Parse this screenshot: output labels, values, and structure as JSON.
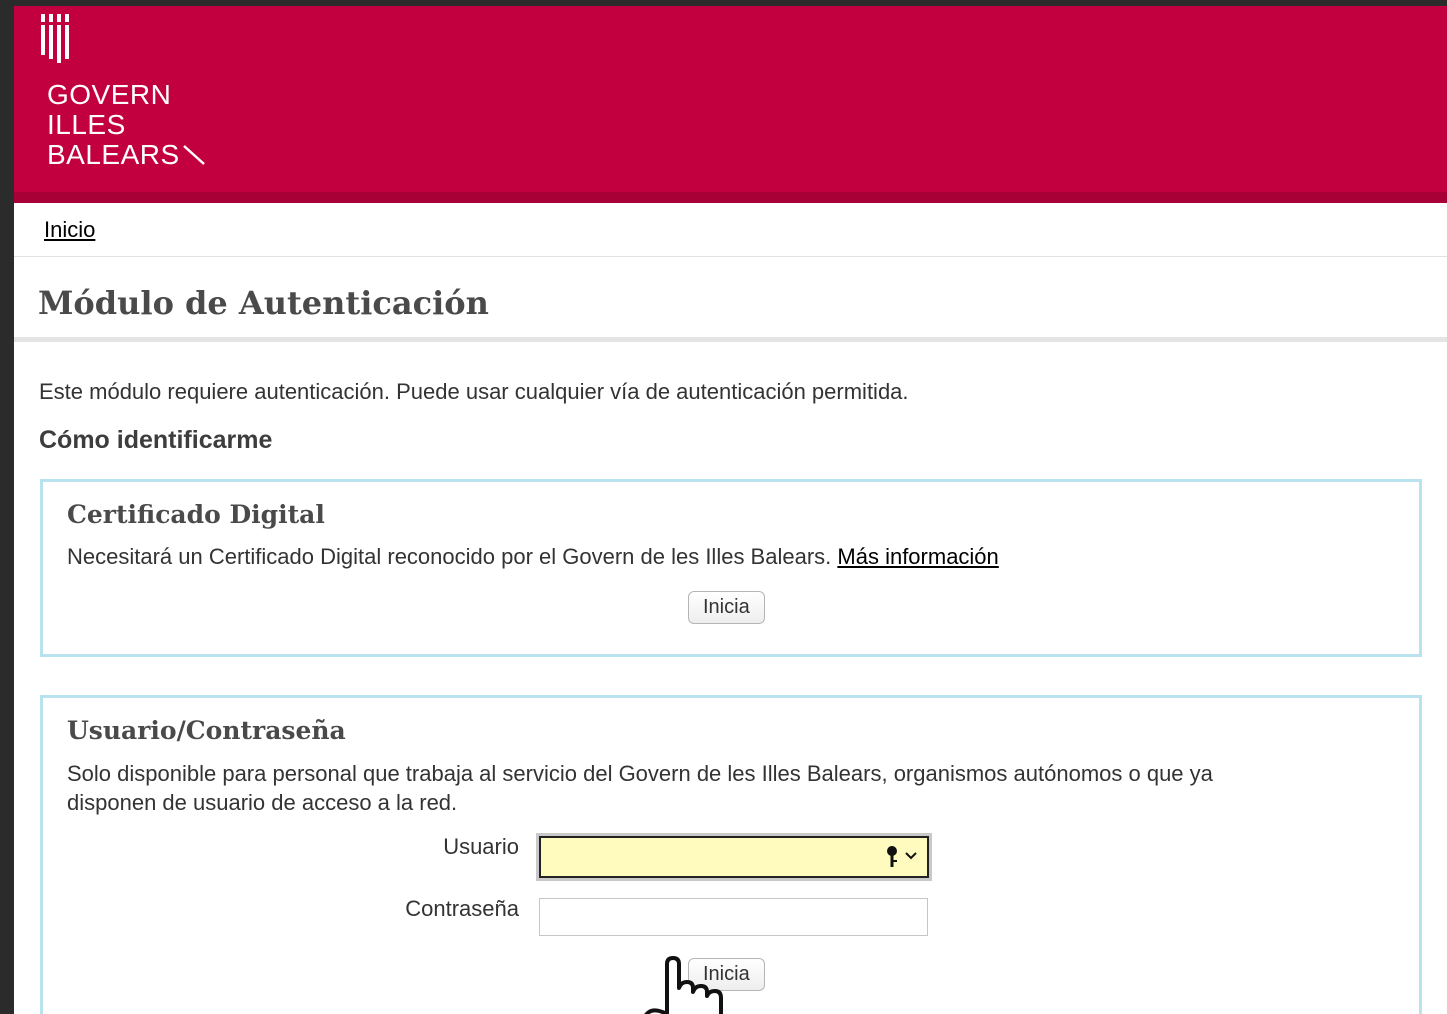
{
  "header": {
    "logo_lines": [
      "GOVERN",
      "ILLES",
      "BALEARS"
    ],
    "brand_color": "#c3003f",
    "logo_icon": "govern-illes-balears-mark"
  },
  "breadcrumb": {
    "home_label": "Inicio"
  },
  "page": {
    "title": "Módulo de Autenticación",
    "intro": "Este módulo requiere autenticación. Puede usar cualquier vía de autenticación permitida.",
    "how_heading": "Cómo identificarme"
  },
  "certificate": {
    "title": "Certificado Digital",
    "description": "Necesitará un Certificado Digital reconocido por el Govern de les Illes Balears.",
    "more_info_label": "Más información",
    "button_label": "Inicia"
  },
  "user_password": {
    "title": "Usuario/Contraseña",
    "description_line1": "Solo disponible para personal que trabaja al servicio del Govern de les Illes Balears, organismos autónomos o que ya",
    "description_line2": "disponen de usuario de acceso a la red.",
    "user_label": "Usuario",
    "user_value": "",
    "password_label": "Contraseña",
    "password_value": "",
    "button_label": "Inicia"
  },
  "icons": {
    "autofill_key": "key-icon",
    "autofill_dropdown": "chevron-down-icon",
    "pointer": "hand-cursor-icon"
  }
}
